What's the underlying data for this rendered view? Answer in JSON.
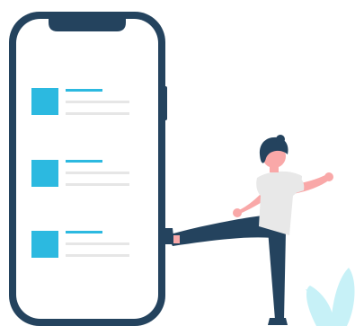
{
  "illustration": {
    "subject": "phone-with-list-and-kicking-person",
    "colors": {
      "phone_frame": "#24435e",
      "phone_screen": "#ffffff",
      "list_thumbnail": "#2cb9e0",
      "list_title_bar": "#2cb9e0",
      "list_text_line": "#e6e6e6",
      "person_hair": "#24435e",
      "person_skin": "#f9a8a8",
      "person_shirt": "#e8e8e8",
      "person_pants": "#24435e",
      "plant_leaf": "#c7f1f7"
    }
  },
  "phone": {
    "list_items": [
      {
        "thumbnail": "square-placeholder",
        "title_bar": true,
        "text_lines": 2
      },
      {
        "thumbnail": "square-placeholder",
        "title_bar": true,
        "text_lines": 2
      },
      {
        "thumbnail": "square-placeholder",
        "title_bar": true,
        "text_lines": 2
      }
    ]
  }
}
